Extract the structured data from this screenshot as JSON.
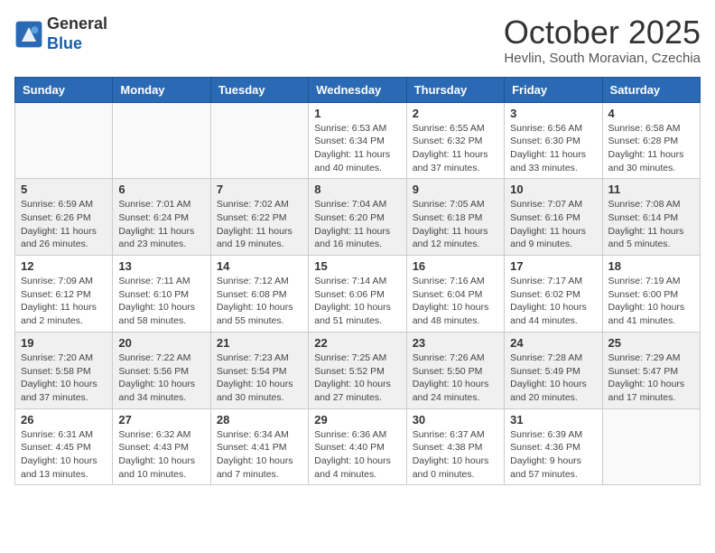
{
  "logo": {
    "line1": "General",
    "line2": "Blue"
  },
  "title": "October 2025",
  "subtitle": "Hevlin, South Moravian, Czechia",
  "days_of_week": [
    "Sunday",
    "Monday",
    "Tuesday",
    "Wednesday",
    "Thursday",
    "Friday",
    "Saturday"
  ],
  "weeks": [
    [
      {
        "day": "",
        "info": ""
      },
      {
        "day": "",
        "info": ""
      },
      {
        "day": "",
        "info": ""
      },
      {
        "day": "1",
        "info": "Sunrise: 6:53 AM\nSunset: 6:34 PM\nDaylight: 11 hours\nand 40 minutes."
      },
      {
        "day": "2",
        "info": "Sunrise: 6:55 AM\nSunset: 6:32 PM\nDaylight: 11 hours\nand 37 minutes."
      },
      {
        "day": "3",
        "info": "Sunrise: 6:56 AM\nSunset: 6:30 PM\nDaylight: 11 hours\nand 33 minutes."
      },
      {
        "day": "4",
        "info": "Sunrise: 6:58 AM\nSunset: 6:28 PM\nDaylight: 11 hours\nand 30 minutes."
      }
    ],
    [
      {
        "day": "5",
        "info": "Sunrise: 6:59 AM\nSunset: 6:26 PM\nDaylight: 11 hours\nand 26 minutes."
      },
      {
        "day": "6",
        "info": "Sunrise: 7:01 AM\nSunset: 6:24 PM\nDaylight: 11 hours\nand 23 minutes."
      },
      {
        "day": "7",
        "info": "Sunrise: 7:02 AM\nSunset: 6:22 PM\nDaylight: 11 hours\nand 19 minutes."
      },
      {
        "day": "8",
        "info": "Sunrise: 7:04 AM\nSunset: 6:20 PM\nDaylight: 11 hours\nand 16 minutes."
      },
      {
        "day": "9",
        "info": "Sunrise: 7:05 AM\nSunset: 6:18 PM\nDaylight: 11 hours\nand 12 minutes."
      },
      {
        "day": "10",
        "info": "Sunrise: 7:07 AM\nSunset: 6:16 PM\nDaylight: 11 hours\nand 9 minutes."
      },
      {
        "day": "11",
        "info": "Sunrise: 7:08 AM\nSunset: 6:14 PM\nDaylight: 11 hours\nand 5 minutes."
      }
    ],
    [
      {
        "day": "12",
        "info": "Sunrise: 7:09 AM\nSunset: 6:12 PM\nDaylight: 11 hours\nand 2 minutes."
      },
      {
        "day": "13",
        "info": "Sunrise: 7:11 AM\nSunset: 6:10 PM\nDaylight: 10 hours\nand 58 minutes."
      },
      {
        "day": "14",
        "info": "Sunrise: 7:12 AM\nSunset: 6:08 PM\nDaylight: 10 hours\nand 55 minutes."
      },
      {
        "day": "15",
        "info": "Sunrise: 7:14 AM\nSunset: 6:06 PM\nDaylight: 10 hours\nand 51 minutes."
      },
      {
        "day": "16",
        "info": "Sunrise: 7:16 AM\nSunset: 6:04 PM\nDaylight: 10 hours\nand 48 minutes."
      },
      {
        "day": "17",
        "info": "Sunrise: 7:17 AM\nSunset: 6:02 PM\nDaylight: 10 hours\nand 44 minutes."
      },
      {
        "day": "18",
        "info": "Sunrise: 7:19 AM\nSunset: 6:00 PM\nDaylight: 10 hours\nand 41 minutes."
      }
    ],
    [
      {
        "day": "19",
        "info": "Sunrise: 7:20 AM\nSunset: 5:58 PM\nDaylight: 10 hours\nand 37 minutes."
      },
      {
        "day": "20",
        "info": "Sunrise: 7:22 AM\nSunset: 5:56 PM\nDaylight: 10 hours\nand 34 minutes."
      },
      {
        "day": "21",
        "info": "Sunrise: 7:23 AM\nSunset: 5:54 PM\nDaylight: 10 hours\nand 30 minutes."
      },
      {
        "day": "22",
        "info": "Sunrise: 7:25 AM\nSunset: 5:52 PM\nDaylight: 10 hours\nand 27 minutes."
      },
      {
        "day": "23",
        "info": "Sunrise: 7:26 AM\nSunset: 5:50 PM\nDaylight: 10 hours\nand 24 minutes."
      },
      {
        "day": "24",
        "info": "Sunrise: 7:28 AM\nSunset: 5:49 PM\nDaylight: 10 hours\nand 20 minutes."
      },
      {
        "day": "25",
        "info": "Sunrise: 7:29 AM\nSunset: 5:47 PM\nDaylight: 10 hours\nand 17 minutes."
      }
    ],
    [
      {
        "day": "26",
        "info": "Sunrise: 6:31 AM\nSunset: 4:45 PM\nDaylight: 10 hours\nand 13 minutes."
      },
      {
        "day": "27",
        "info": "Sunrise: 6:32 AM\nSunset: 4:43 PM\nDaylight: 10 hours\nand 10 minutes."
      },
      {
        "day": "28",
        "info": "Sunrise: 6:34 AM\nSunset: 4:41 PM\nDaylight: 10 hours\nand 7 minutes."
      },
      {
        "day": "29",
        "info": "Sunrise: 6:36 AM\nSunset: 4:40 PM\nDaylight: 10 hours\nand 4 minutes."
      },
      {
        "day": "30",
        "info": "Sunrise: 6:37 AM\nSunset: 4:38 PM\nDaylight: 10 hours\nand 0 minutes."
      },
      {
        "day": "31",
        "info": "Sunrise: 6:39 AM\nSunset: 4:36 PM\nDaylight: 9 hours\nand 57 minutes."
      },
      {
        "day": "",
        "info": ""
      }
    ]
  ]
}
